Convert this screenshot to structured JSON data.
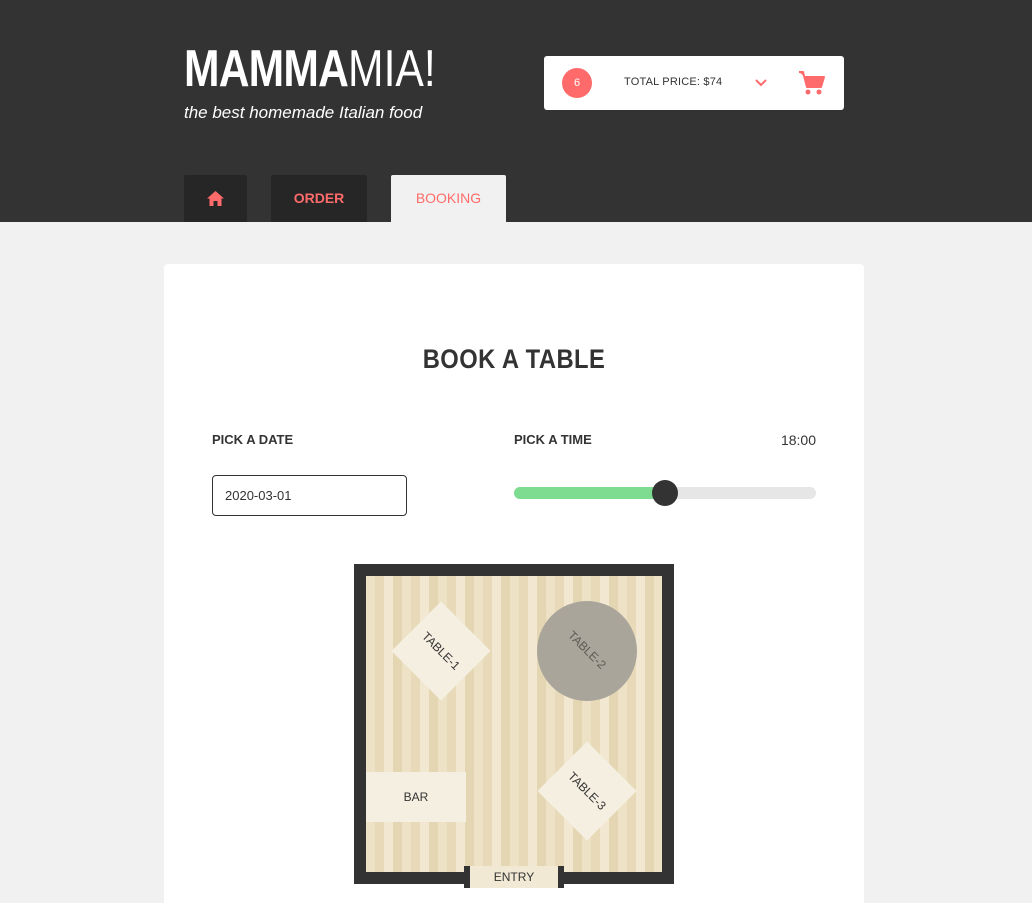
{
  "brand": {
    "name_bold": "MAMMA",
    "name_light": "MIA!",
    "tagline": "the best homemade Italian food"
  },
  "cart": {
    "count": "6",
    "total_label": "TOTAL PRICE: $74",
    "chevron_icon": "chevron-down-icon",
    "cart_icon": "shopping-cart-icon",
    "accent": "#ff6b6b"
  },
  "nav": {
    "home_icon": "home-icon",
    "order_label": "ORDER",
    "booking_label": "BOOKING"
  },
  "booking": {
    "title": "BOOK A TABLE",
    "date_label": "PICK A DATE",
    "date_value": "2020-03-01",
    "time_label": "PICK A TIME",
    "time_value": "18:00",
    "time_slider_fraction": 0.5
  },
  "floor_plan": {
    "table_1": "TABLE-1",
    "table_2": "TABLE-2",
    "table_3": "TABLE-3",
    "bar": "BAR",
    "entry": "ENTRY"
  },
  "colors": {
    "header_bg": "#333333",
    "accent": "#ff6b6b",
    "slider_fill": "#7ddc8f",
    "booked_table": "#aaa59b"
  }
}
